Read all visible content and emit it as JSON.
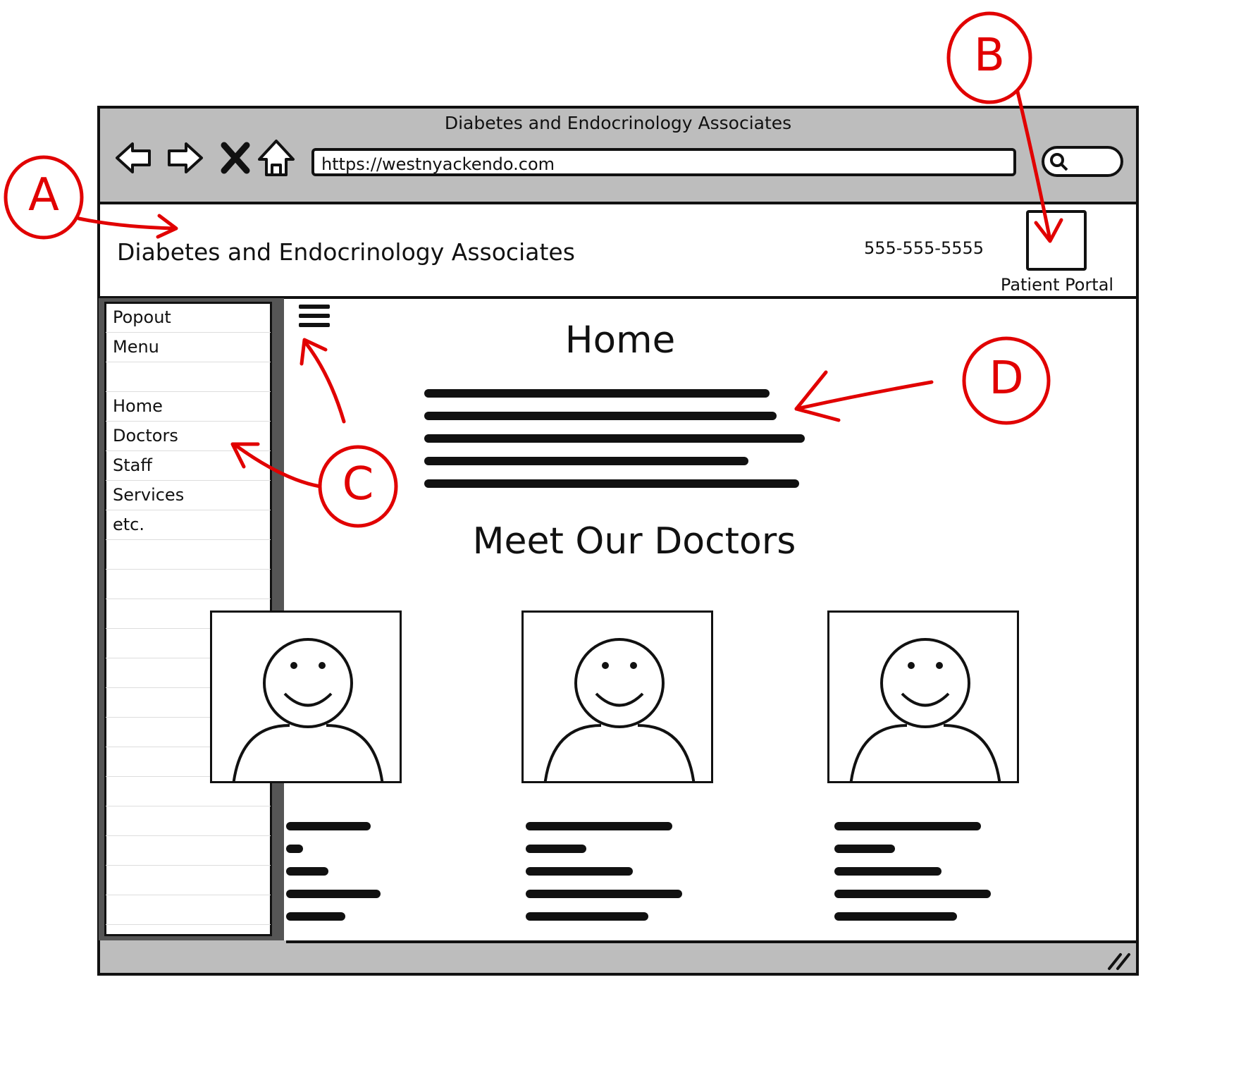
{
  "browser": {
    "window_title": "Diabetes and Endocrinology Associates",
    "url": "https://westnyackendo.com"
  },
  "header": {
    "site_title": "Diabetes and Endocrinology Associates",
    "phone": "555-555-5555",
    "portal_label": "Patient Portal"
  },
  "menu": {
    "title_line1": "Popout",
    "title_line2": "Menu",
    "items": [
      {
        "label": "Home"
      },
      {
        "label": "Doctors"
      },
      {
        "label": "Staff"
      },
      {
        "label": "Services"
      },
      {
        "label": "etc."
      }
    ]
  },
  "main": {
    "home_heading": "Home",
    "doctors_heading": "Meet Our Doctors"
  },
  "annotations": {
    "a": "A",
    "b": "B",
    "c": "C",
    "d": "D"
  },
  "colors": {
    "annotation": "#e10000",
    "chrome": "#bdbdbd"
  }
}
